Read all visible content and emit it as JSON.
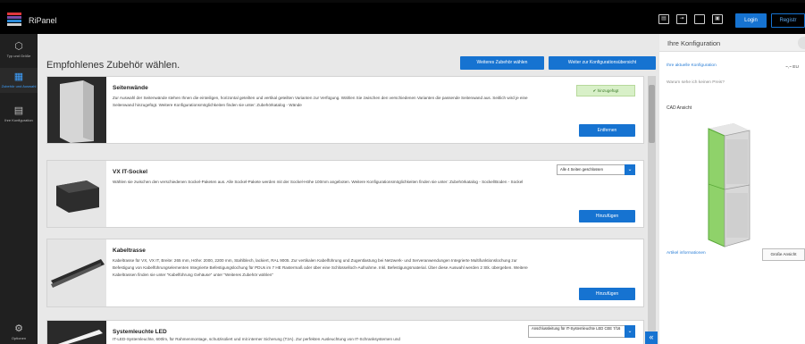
{
  "app": {
    "title": "RiPanel"
  },
  "topbar": {
    "icons": [
      "pdf-icon",
      "export-icon",
      "fullscreen-icon",
      "save-icon"
    ],
    "login_label": "Login",
    "register_label": "Registr"
  },
  "rail": {
    "items": [
      {
        "label": "Typ und Größe",
        "icon": "cube-icon"
      },
      {
        "label": "Zubehör und Auswahl",
        "icon": "accessory-icon",
        "active": true
      },
      {
        "label": "Ihre Konfiguration",
        "icon": "list-icon"
      },
      {
        "label": "Optionen",
        "icon": "gear-icon"
      }
    ]
  },
  "main": {
    "title": "Empfohlenes Zubehör wählen.",
    "btn_more": "Weiteres Zubehör wählen",
    "btn_overview": "Weiter zur Konfigurationsübersicht",
    "cards": [
      {
        "title": "Seitenwände",
        "badge": "✔ hinzugefügt",
        "desc": "Zur Auswahl der Seitenwände stehen Ihnen die einteiligen, horizontal geteilten und vertikal geteilten Varianten zur Verfügung. Wählen Sie zwischen den verschiedenen Varianten die passende Seitenwand aus. Seitlich wird je eine Seitenwand hinzugefügt. Weitere Konfigurationsmöglichkeiten finden sie unter: Zubehörkatalog - Wände",
        "action": "Entfernen"
      },
      {
        "title": "VX IT-Sockel",
        "select": "Alle 4 Seiten geschlossen",
        "desc": "Wählen sie zwischen den verschiedenen Sockel-Paketen aus. Alle Sockel-Pakete werden mit der Sockel-Höhe 100mm angeboten. Weitere Konfigurationsmöglichkeiten finden sie unter: Zubehörkatalog - Sockel/Boden - Sockel",
        "action": "Hinzufügen"
      },
      {
        "title": "Kabeltrasse",
        "desc": "Kabeltrasse für VX, VX IT, Breite: 265 mm, Höhe: 2000, 2200 mm, Stahlblech, lackiert, RAL 9005. Zur vertikalen Kabelführung und Zugentlastung bei Netzwerk- und Serveranwendungen Integrierte Multifunktionslochung zur Befestigung von Kabelführungselementen Integrierte Befestigungslochung für PDUs im 7 HE Rastermaß oder über eine Schlüsselloch-Aufnahme. Inkl. Befestigungsmaterial. Über diese Auswahl werden 2 Stk. übergeben. Weitere Kabeltrassen finden sie unter \"Kabelführung Gehäuse\" unter \"Weiteres Zubehör wählen\"",
        "action": "Hinzufügen"
      },
      {
        "title": "Systemleuchte LED",
        "select": "Anschlussleitung für IT-Systemleuchte LED CEE 7/16",
        "desc": "IT-LED-Systemleuchte, 600lm, für Rahmenmontage, schutzisoliert und mit interner Sicherung (T2A). Zur perfekten Ausleuchtung von IT-Schranksystemen und"
      }
    ]
  },
  "side": {
    "title": "Ihre Konfiguration",
    "current_config": "Ihre aktuelle Konfiguration",
    "price": "~,~ EU",
    "why_no_price": "Warum sehe ich keinen Preis?",
    "cad_label": "CAD Ansicht",
    "article_info": "Artikel informationen",
    "big_view": "Große Ansicht"
  },
  "colors": {
    "accent": "#1673d1",
    "added_bg": "#d8f0c8"
  }
}
